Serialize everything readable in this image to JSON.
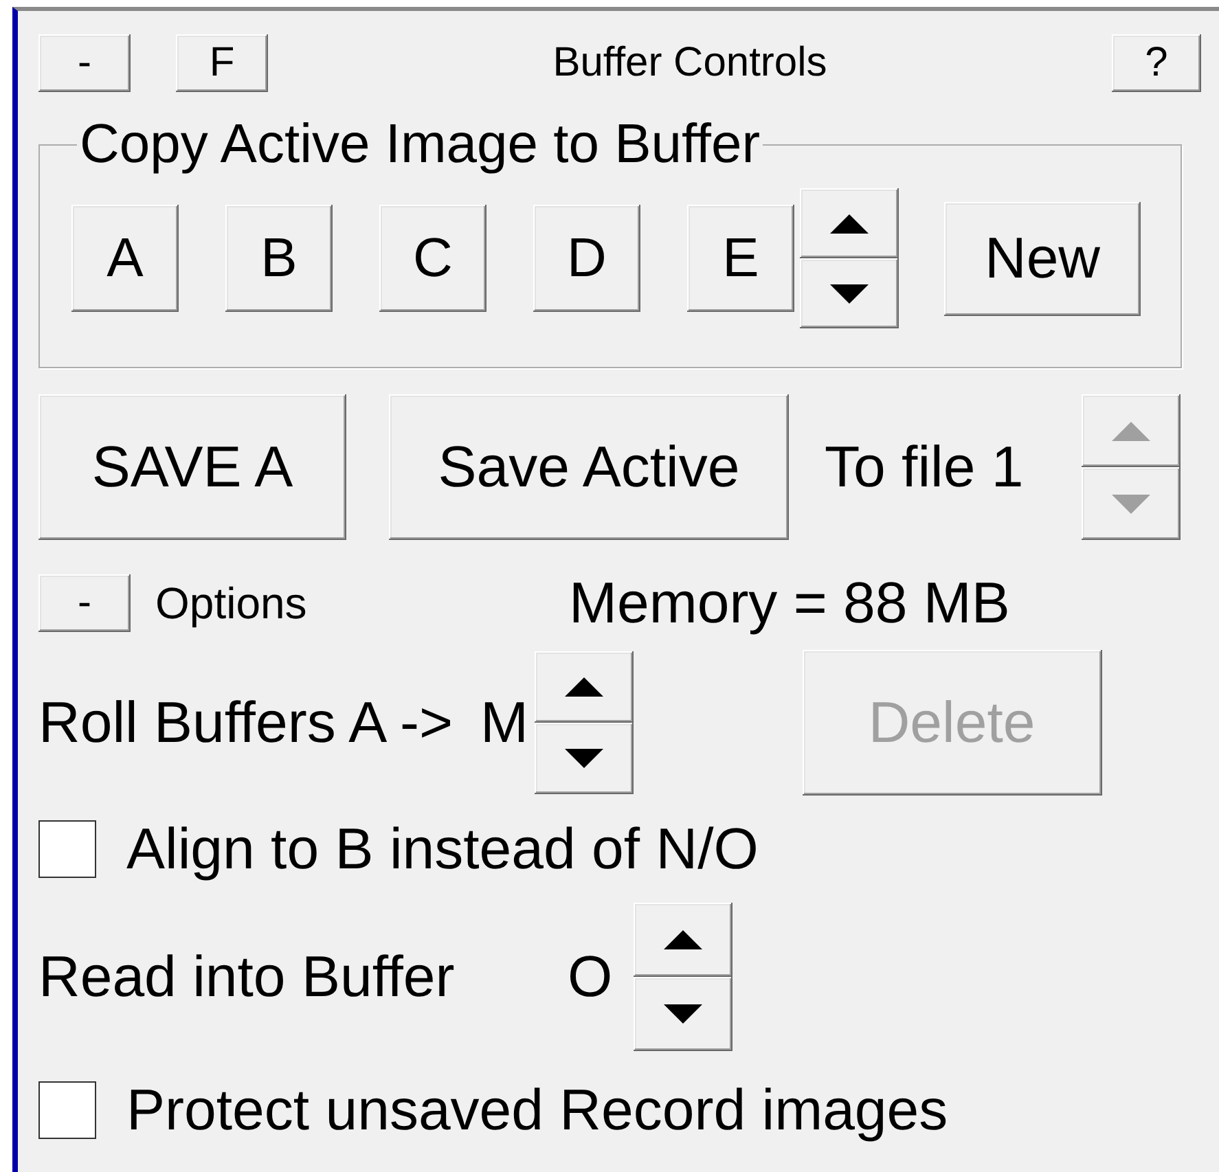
{
  "header": {
    "collapse_button": "-",
    "float_button": "F",
    "title": "Buffer Controls",
    "help_button": "?"
  },
  "copy_group": {
    "legend": "Copy Active Image to Buffer",
    "buffers": [
      "A",
      "B",
      "C",
      "D",
      "E"
    ],
    "new_button": "New"
  },
  "save": {
    "save_buffer_button": "SAVE A",
    "save_active_button": "Save Active",
    "to_file_label": "To file 1",
    "file_spinner_disabled": true
  },
  "options": {
    "collapse_button": "-",
    "label": "Options",
    "memory": "Memory = 88 MB"
  },
  "roll": {
    "label": "Roll Buffers A ->",
    "buffer": "M",
    "delete_button": {
      "label": "Delete",
      "disabled": true
    }
  },
  "align_checkbox": {
    "label": "Align to B instead of N/O",
    "checked": false
  },
  "read": {
    "label": "Read into Buffer",
    "buffer": "O"
  },
  "protect_checkbox": {
    "label": "Protect unsaved Record images",
    "checked": false
  }
}
